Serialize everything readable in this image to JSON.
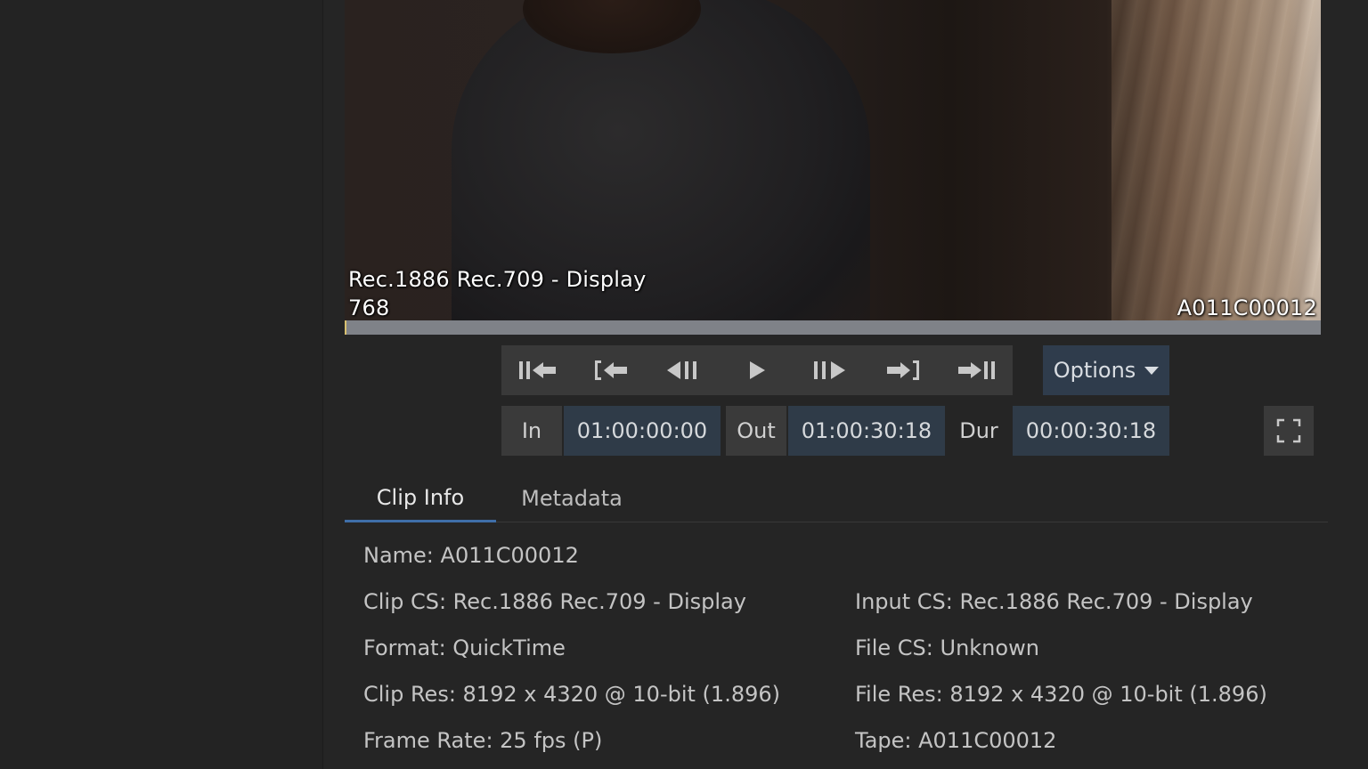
{
  "viewer": {
    "colorspace_overlay": "Rec.1886 Rec.709 - Display",
    "frame_number": "768",
    "clip_name_overlay": "A011C00012",
    "playhead_fraction": 0.0
  },
  "transport": {
    "buttons": [
      {
        "name": "go-to-start-icon"
      },
      {
        "name": "go-to-in-icon"
      },
      {
        "name": "step-back-icon"
      },
      {
        "name": "play-icon"
      },
      {
        "name": "step-forward-icon"
      },
      {
        "name": "go-to-out-icon"
      },
      {
        "name": "go-to-end-icon"
      }
    ],
    "options_label": "Options"
  },
  "timecode": {
    "in_label": "In",
    "in_value": "01:00:00:00",
    "out_label": "Out",
    "out_value": "01:00:30:18",
    "dur_label": "Dur",
    "dur_value": "00:00:30:18"
  },
  "tabs": {
    "clip_info": "Clip Info",
    "metadata": "Metadata"
  },
  "clip_info": {
    "name": "Name: A011C00012",
    "clip_cs": "Clip CS: Rec.1886 Rec.709 - Display",
    "input_cs": "Input CS: Rec.1886 Rec.709 - Display",
    "format": "Format: QuickTime",
    "file_cs": "File CS: Unknown",
    "clip_res": "Clip Res: 8192 x 4320 @ 10-bit (1.896)",
    "file_res": "File Res: 8192 x 4320 @ 10-bit (1.896)",
    "frame_rate": "Frame Rate: 25 fps (P)",
    "tape": "Tape: A011C00012"
  },
  "colors": {
    "accent": "#3f6ea8",
    "timecode_bg": "#2f3b48",
    "background": "#252525"
  }
}
